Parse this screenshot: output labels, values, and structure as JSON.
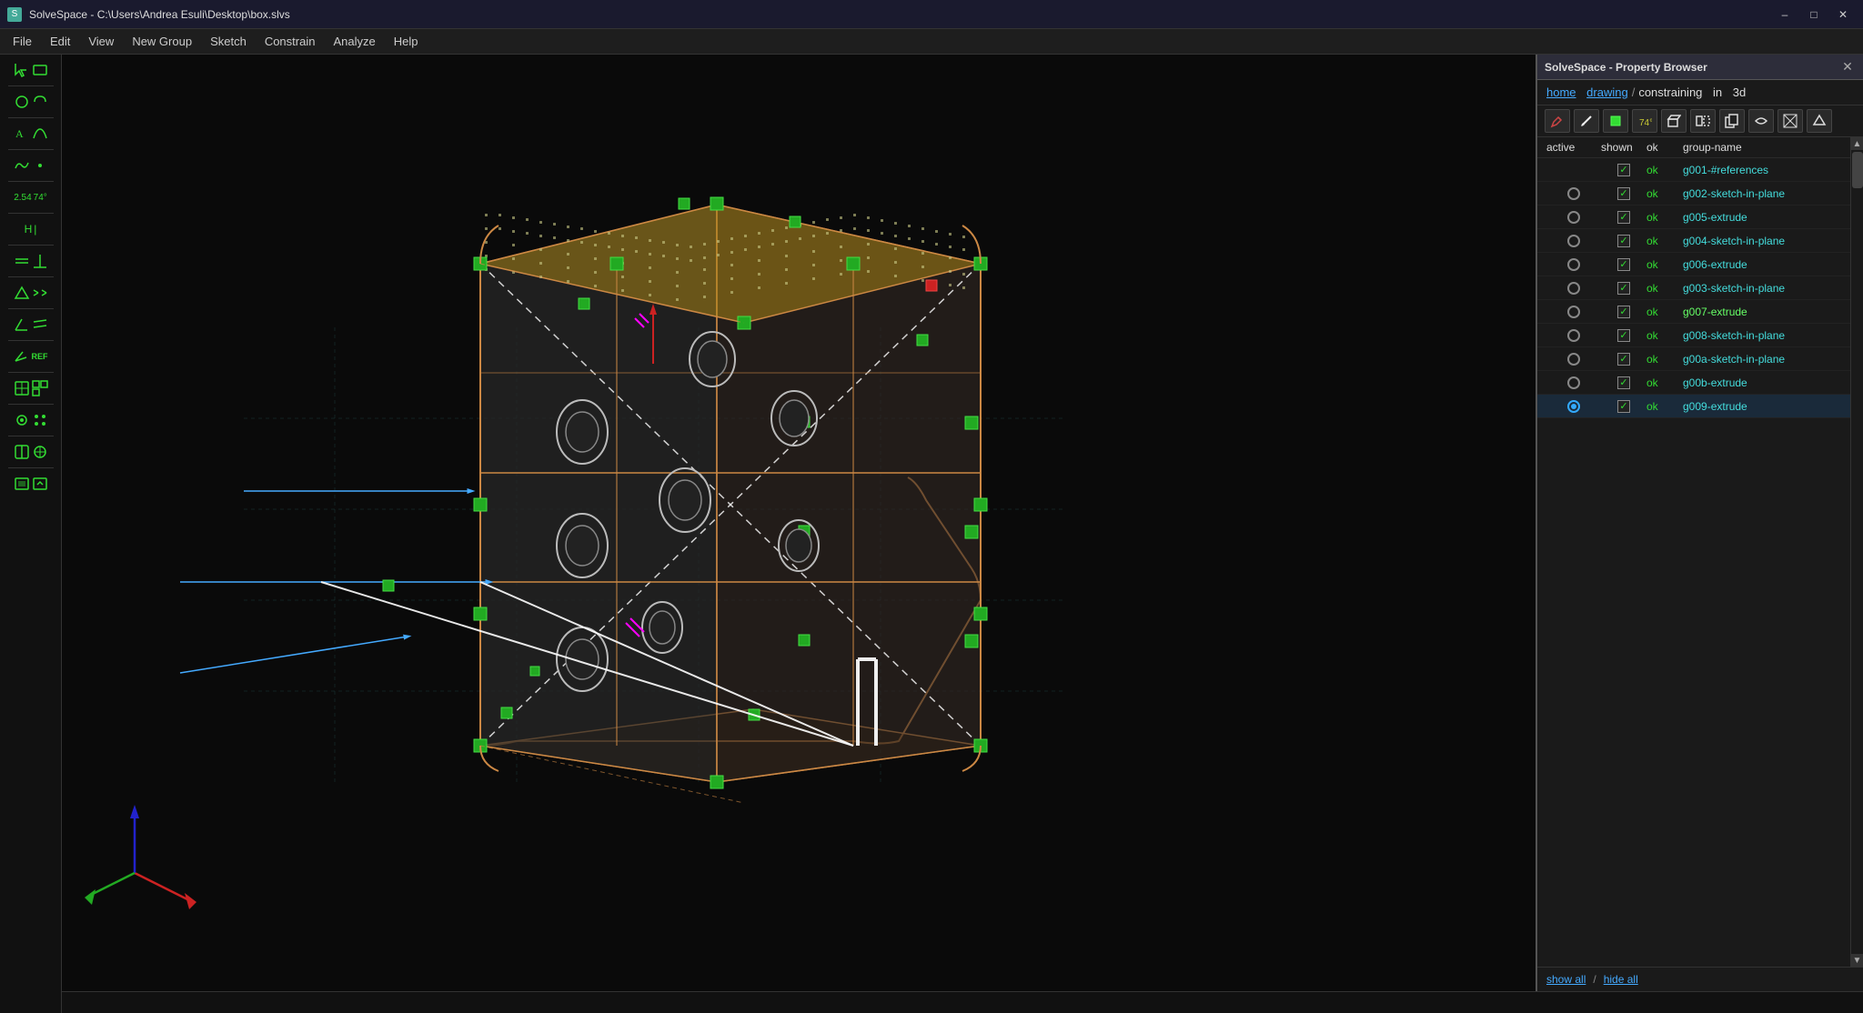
{
  "titlebar": {
    "title": "SolveSpace - C:\\Users\\Andrea Esuli\\Desktop\\box.slvs",
    "controls": {
      "minimize": "–",
      "maximize": "□",
      "close": "✕"
    }
  },
  "menubar": {
    "items": [
      "File",
      "Edit",
      "View",
      "New Group",
      "Sketch",
      "Constrain",
      "Analyze",
      "Help"
    ]
  },
  "toolbar": {
    "tools": [
      {
        "name": "select-tool",
        "label": "↖",
        "group": 1
      },
      {
        "name": "rect-tool",
        "label": "▭",
        "group": 1
      },
      {
        "name": "circle-tool",
        "label": "○",
        "group": 2
      },
      {
        "name": "arc-tool",
        "label": "⌒",
        "group": 2
      },
      {
        "name": "text-tool",
        "label": "A",
        "group": 3
      },
      {
        "name": "bezier-tool",
        "label": "∫",
        "group": 3
      },
      {
        "name": "spline-tool",
        "label": "~",
        "group": 4
      },
      {
        "name": "point-tool",
        "label": "•",
        "group": 4
      },
      {
        "name": "measure-tool",
        "label": "2.54",
        "group": 5
      },
      {
        "name": "angle-tool",
        "label": "74°",
        "group": 5
      },
      {
        "name": "horiz-tool",
        "label": "H",
        "group": 6
      },
      {
        "name": "vert-tool",
        "label": "|",
        "group": 6
      },
      {
        "name": "equal-tool",
        "label": "=",
        "group": 7
      },
      {
        "name": "perp-tool",
        "label": "⊥",
        "group": 7
      },
      {
        "name": "at-mid-tool",
        "label": "◁",
        "group": 8
      },
      {
        "name": "symm-tool",
        "label": "⇔",
        "group": 8
      },
      {
        "name": "tri-tool",
        "label": "△",
        "group": 9
      },
      {
        "name": "parallel-tool",
        "label": "∥",
        "group": 9
      },
      {
        "name": "angle2-tool",
        "label": "∠",
        "group": 10
      },
      {
        "name": "ref-tool",
        "label": "REF",
        "group": 10
      },
      {
        "name": "view-tool",
        "label": "⊡",
        "group": 11
      },
      {
        "name": "layer-tool",
        "label": "⧉",
        "group": 11
      },
      {
        "name": "step-tool",
        "label": "⊛",
        "group": 12
      },
      {
        "name": "array-tool",
        "label": "⊞",
        "group": 12
      },
      {
        "name": "link-tool",
        "label": "⛓",
        "group": 13
      },
      {
        "name": "snap-tool",
        "label": "⊕",
        "group": 13
      },
      {
        "name": "import-tool",
        "label": "⊡",
        "group": 14
      },
      {
        "name": "export-tool",
        "label": "⤴",
        "group": 14
      }
    ]
  },
  "property_browser": {
    "title": "SolveSpace - Property Browser",
    "breadcrumb": {
      "home": "home",
      "drawing": "drawing",
      "separator1": "/",
      "constraining": "constraining",
      "separator2": "in",
      "context": "3d"
    },
    "toolbar_icons": [
      "sketch-icon",
      "pencil-icon",
      "green-dot-icon",
      "angle-icon",
      "extrude-icon",
      "mirror-icon",
      "copy-icon",
      "revolve-icon",
      "helix-icon",
      "import3d-icon"
    ],
    "column_headers": {
      "active": "active",
      "shown": "shown",
      "ok": "ok",
      "group_name": "group-name"
    },
    "groups": [
      {
        "id": 1,
        "active": false,
        "radio": "empty",
        "shown": true,
        "ok_text": "ok",
        "name": "g001-#references",
        "name_color": "cyan"
      },
      {
        "id": 2,
        "active": false,
        "radio": "empty",
        "shown": true,
        "ok_text": "ok",
        "name": "g002-sketch-in-plane",
        "name_color": "cyan"
      },
      {
        "id": 3,
        "active": false,
        "radio": "empty",
        "shown": true,
        "ok_text": "ok",
        "name": "g005-extrude",
        "name_color": "cyan"
      },
      {
        "id": 4,
        "active": false,
        "radio": "empty",
        "shown": true,
        "ok_text": "ok",
        "name": "g004-sketch-in-plane",
        "name_color": "cyan"
      },
      {
        "id": 5,
        "active": false,
        "radio": "empty",
        "shown": true,
        "ok_text": "ok",
        "name": "g006-extrude",
        "name_color": "cyan"
      },
      {
        "id": 6,
        "active": false,
        "radio": "empty",
        "shown": true,
        "ok_text": "ok",
        "name": "g003-sketch-in-plane",
        "name_color": "cyan"
      },
      {
        "id": 7,
        "active": false,
        "radio": "empty",
        "shown": true,
        "ok_text": "ok",
        "name": "g007-extrude",
        "name_color": "green"
      },
      {
        "id": 8,
        "active": false,
        "radio": "empty",
        "shown": true,
        "ok_text": "ok",
        "name": "g008-sketch-in-plane",
        "name_color": "cyan"
      },
      {
        "id": 9,
        "active": false,
        "radio": "empty",
        "shown": true,
        "ok_text": "ok",
        "name": "g00a-sketch-in-plane",
        "name_color": "cyan"
      },
      {
        "id": 10,
        "active": false,
        "radio": "empty",
        "shown": true,
        "ok_text": "ok",
        "name": "g00b-extrude",
        "name_color": "cyan"
      },
      {
        "id": 11,
        "active": true,
        "radio": "filled",
        "shown": true,
        "ok_text": "ok",
        "name": "g009-extrude",
        "name_color": "cyan"
      }
    ],
    "footer": {
      "show_all": "show all",
      "separator": "/",
      "hide_all": "hide all"
    }
  },
  "statusbar": {
    "text": ""
  }
}
